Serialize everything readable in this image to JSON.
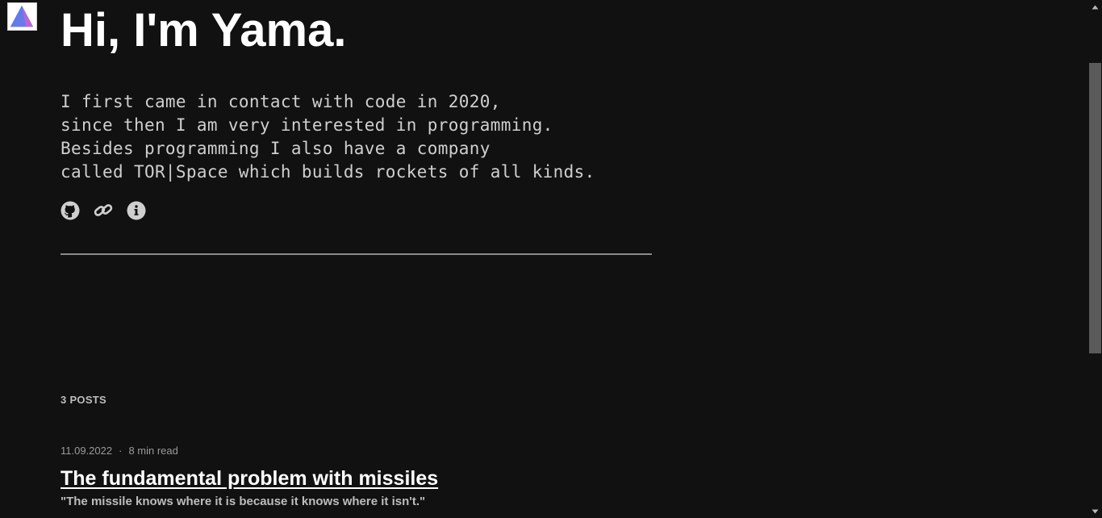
{
  "header": {
    "logo_icon": "triangle-logo-icon",
    "headline": "Hi, I'm Yama."
  },
  "intro": {
    "lines": [
      "I first came in contact with code in 2020,",
      "since then I am very interested in programming.",
      "Besides programming I also have a company",
      "called TOR|Space which builds rockets of all kinds."
    ]
  },
  "socials": [
    {
      "icon": "github-icon"
    },
    {
      "icon": "link-icon"
    },
    {
      "icon": "info-icon"
    }
  ],
  "posts": {
    "count_label": "3 POSTS",
    "items": [
      {
        "date": "11.09.2022",
        "separator": "·",
        "read_time": "8 min read",
        "title": "The fundamental problem with missiles",
        "excerpt": "\"The missile knows where it is because it knows where it isn't.\""
      }
    ]
  },
  "colors": {
    "background": "#111112",
    "heading": "#ffffff",
    "body_text": "#cfcfcf",
    "muted_text": "#9a9a9a",
    "divider": "#8a8a8a",
    "scroll_thumb": "#5a5a5a"
  }
}
